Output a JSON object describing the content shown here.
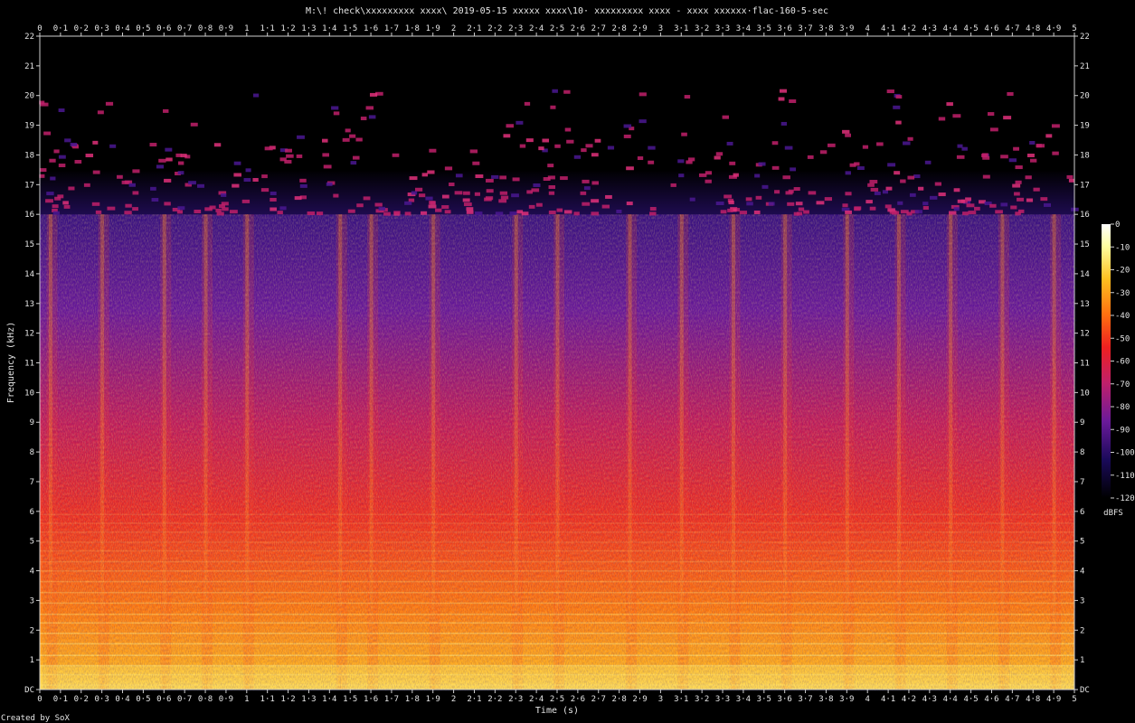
{
  "chart_data": {
    "type": "heatmap",
    "title": "M:\\! check\\xxxxxxxxx xxxx\\ 2019-05-15  xxxxx xxxx\\10· xxxxxxxxx xxxx - xxxx xxxxxx·flac-160-5-sec",
    "xlabel": "Time (s)",
    "ylabel": "Frequency (kHz)",
    "x_range": [
      0,
      5
    ],
    "y_range": [
      0,
      22
    ],
    "x_ticks": [
      "0",
      "0·1",
      "0·2",
      "0·3",
      "0·4",
      "0·5",
      "0·6",
      "0·7",
      "0·8",
      "0·9",
      "1",
      "1·1",
      "1·2",
      "1·3",
      "1·4",
      "1·5",
      "1·6",
      "1·7",
      "1·8",
      "1·9",
      "2",
      "2·1",
      "2·2",
      "2·3",
      "2·4",
      "2·5",
      "2·6",
      "2·7",
      "2·8",
      "2·9",
      "3",
      "3·1",
      "3·2",
      "3·3",
      "3·4",
      "3·5",
      "3·6",
      "3·7",
      "3·8",
      "3·9",
      "4",
      "4·1",
      "4·2",
      "4·3",
      "4·4",
      "4·5",
      "4·6",
      "4·7",
      "4·8",
      "4·9",
      "5"
    ],
    "y_ticks": [
      "DC",
      "1",
      "2",
      "3",
      "4",
      "5",
      "6",
      "7",
      "8",
      "9",
      "10",
      "11",
      "12",
      "13",
      "14",
      "15",
      "16",
      "17",
      "18",
      "19",
      "20",
      "21",
      "22"
    ],
    "colorbar": {
      "label": "dBFS",
      "range": [
        -120,
        0
      ],
      "ticks": [
        "0",
        "-10",
        "-20",
        "-30",
        "-40",
        "-50",
        "-60",
        "-70",
        "-80",
        "-90",
        "-100",
        "-110",
        "-120"
      ],
      "colors": [
        "#000000",
        "#1a0a5a",
        "#6a1a9a",
        "#c0206a",
        "#ee2020",
        "#ff7010",
        "#ffc020",
        "#ffffa0",
        "#ffffff"
      ]
    },
    "lowpass_cutoff_khz": 16,
    "note_onsets_s": [
      0.05,
      0.3,
      0.6,
      0.8,
      1.0,
      1.45,
      1.6,
      1.9,
      2.3,
      2.5,
      2.85,
      3.1,
      3.35,
      3.6,
      3.9,
      4.15,
      4.4,
      4.65,
      4.9
    ],
    "grid": false,
    "legend": "none"
  },
  "footer": {
    "credit": "Created by SoX"
  }
}
